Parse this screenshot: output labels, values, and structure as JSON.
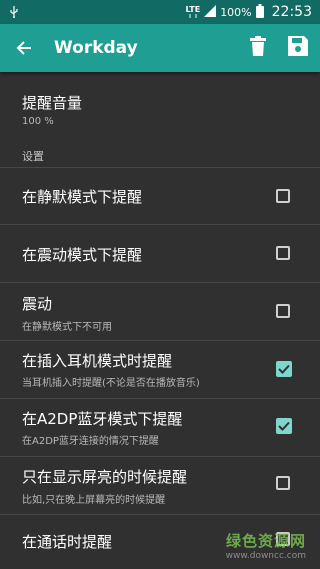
{
  "status_bar": {
    "network": "LTE",
    "battery": "100%",
    "time": "22:53",
    "icons": [
      "usb-icon",
      "signal-icon",
      "battery-icon"
    ]
  },
  "app_bar": {
    "title": "Workday",
    "color": "#1f9f93",
    "icons": [
      "back-arrow-icon",
      "trash-icon",
      "save-icon"
    ]
  },
  "volume": {
    "title": "提醒音量",
    "value": "100 %"
  },
  "section_label": "设置",
  "settings": [
    {
      "title": "在静默模式下提醒",
      "subtitle": "",
      "checked": false
    },
    {
      "title": "在震动模式下提醒",
      "subtitle": "",
      "checked": false
    },
    {
      "title": "震动",
      "subtitle": "在静默模式下不可用",
      "checked": false
    },
    {
      "title": "在插入耳机模式时提醒",
      "subtitle": "当耳机插入时提醒(不论是否在播放音乐)",
      "checked": true
    },
    {
      "title": "在A2DP蓝牙模式下提醒",
      "subtitle": "在A2DP蓝牙连接的情况下提醒",
      "checked": true
    },
    {
      "title": "只在显示屏亮的时候提醒",
      "subtitle": "比如,只在晚上屏幕亮的时候提醒",
      "checked": false
    },
    {
      "title": "在通话时提醒",
      "subtitle": "",
      "checked": false
    }
  ],
  "watermark": {
    "line1": "绿色资源网",
    "line2": "www.downcc.com"
  },
  "colors": {
    "status_bar": "#116a63",
    "background": "#303030",
    "checkbox_checked": "#7fd6cf"
  }
}
